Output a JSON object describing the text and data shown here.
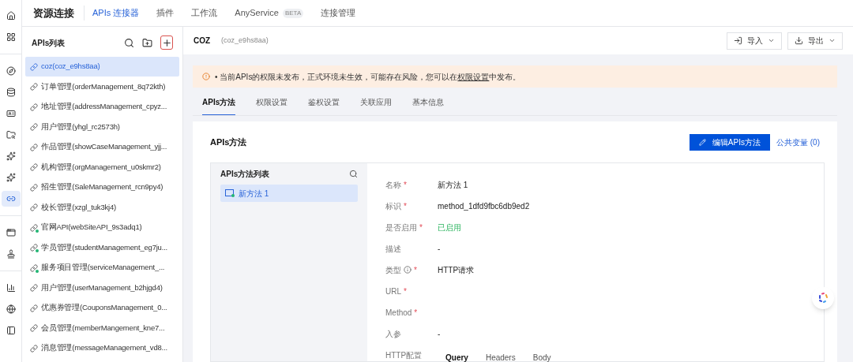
{
  "rail": {
    "items": [
      {
        "selected": false
      },
      {
        "selected": false
      },
      {
        "selected": false
      },
      {
        "selected": false
      },
      {
        "selected": false
      },
      {
        "selected": false
      },
      {
        "selected": false
      },
      {
        "selected": false
      },
      {
        "selected": true
      },
      {
        "selected": false
      },
      {
        "selected": false
      },
      {
        "selected": false
      },
      {
        "selected": false
      },
      {
        "selected": false
      }
    ]
  },
  "app_title": "资源连接",
  "nav_tabs": [
    {
      "label": "APIs 连接器",
      "selected": true
    },
    {
      "label": "插件",
      "selected": false
    },
    {
      "label": "工作流",
      "selected": false
    },
    {
      "label": "AnyService",
      "badge": "BETA",
      "selected": false
    },
    {
      "label": "连接管理",
      "selected": false
    }
  ],
  "sidebar": {
    "title": "APIs列表",
    "items": [
      {
        "label": "coz(coz_e9hs8aa)",
        "published": false,
        "selected": true
      },
      {
        "label": "订单管理(orderManagement_8q72kth)",
        "published": false,
        "selected": false
      },
      {
        "label": "地址管理(addressManagement_cpyz...",
        "published": false,
        "selected": false
      },
      {
        "label": "用户管理(yhgl_rc2573h)",
        "published": false,
        "selected": false
      },
      {
        "label": "作品管理(showCaseManagement_yjj...",
        "published": false,
        "selected": false
      },
      {
        "label": "机构管理(orgManagement_u0skmr2)",
        "published": false,
        "selected": false
      },
      {
        "label": "招生管理(SaleManagement_rcn9py4)",
        "published": false,
        "selected": false
      },
      {
        "label": "校长管理(xzgl_tuk3kj4)",
        "published": false,
        "selected": false
      },
      {
        "label": "官网API(webSiteAPI_9s3adq1)",
        "published": true,
        "selected": false
      },
      {
        "label": "学员管理(studentManagement_eg7ju...",
        "published": true,
        "selected": false
      },
      {
        "label": "服务项目管理(serviceManagement_...",
        "published": true,
        "selected": false
      },
      {
        "label": "用户管理(userManagement_b2hjgd4)",
        "published": false,
        "selected": false
      },
      {
        "label": "优惠券管理(CouponsManagement_0...",
        "published": false,
        "selected": false
      },
      {
        "label": "会员管理(memberMangement_kne7...",
        "published": false,
        "selected": false
      },
      {
        "label": "消息管理(messageManagement_vd8...",
        "published": false,
        "selected": false
      }
    ]
  },
  "header": {
    "name": "COZ",
    "id": "(coz_e9hs8aa)",
    "buttons": [
      "导入",
      "导出"
    ]
  },
  "alert": {
    "text": "• 当前APIs的权限未发布，正式环境未生效，可能存在风险，您可以在",
    "link": "权限设置",
    "suffix": "中发布。"
  },
  "content_tabs": [
    {
      "label": "APIs方法",
      "selected": true
    },
    {
      "label": "权限设置",
      "selected": false
    },
    {
      "label": "鉴权设置",
      "selected": false
    },
    {
      "label": "关联应用",
      "selected": false
    },
    {
      "label": "基本信息",
      "selected": false
    }
  ],
  "card": {
    "title": "APIs方法",
    "edit_button": "编辑APIs方法",
    "variables_link": "公共变量",
    "variables_count": "(0)"
  },
  "method_list": {
    "title": "APIs方法列表",
    "items": [
      {
        "label": "新方法 1",
        "selected": true
      }
    ]
  },
  "fields": [
    {
      "label": "名称",
      "required_mark": "*",
      "kind": "text",
      "value": "新方法 1"
    },
    {
      "label": "标识",
      "required_mark": "*",
      "kind": "text",
      "value": "method_1dfd9fbc6db9ed2"
    },
    {
      "label": "是否启用",
      "required_mark": "*",
      "kind": "status",
      "value": "已启用"
    },
    {
      "label": "描述",
      "kind": "text",
      "value": "-"
    },
    {
      "label": "类型",
      "info": true,
      "required_mark": "*",
      "kind": "text",
      "value": "HTTP请求"
    },
    {
      "label": "URL",
      "required_mark": "*",
      "kind": "text"
    },
    {
      "label": "Method",
      "required_mark": "*",
      "kind": "text"
    },
    {
      "label": "入参",
      "kind": "text",
      "value": "-"
    },
    {
      "label": "HTTP配置",
      "kind": "tabs",
      "tabs": [
        {
          "label": "Query",
          "selected": true
        },
        {
          "label": "Headers",
          "selected": false
        },
        {
          "label": "Body",
          "selected": false
        }
      ]
    }
  ]
}
